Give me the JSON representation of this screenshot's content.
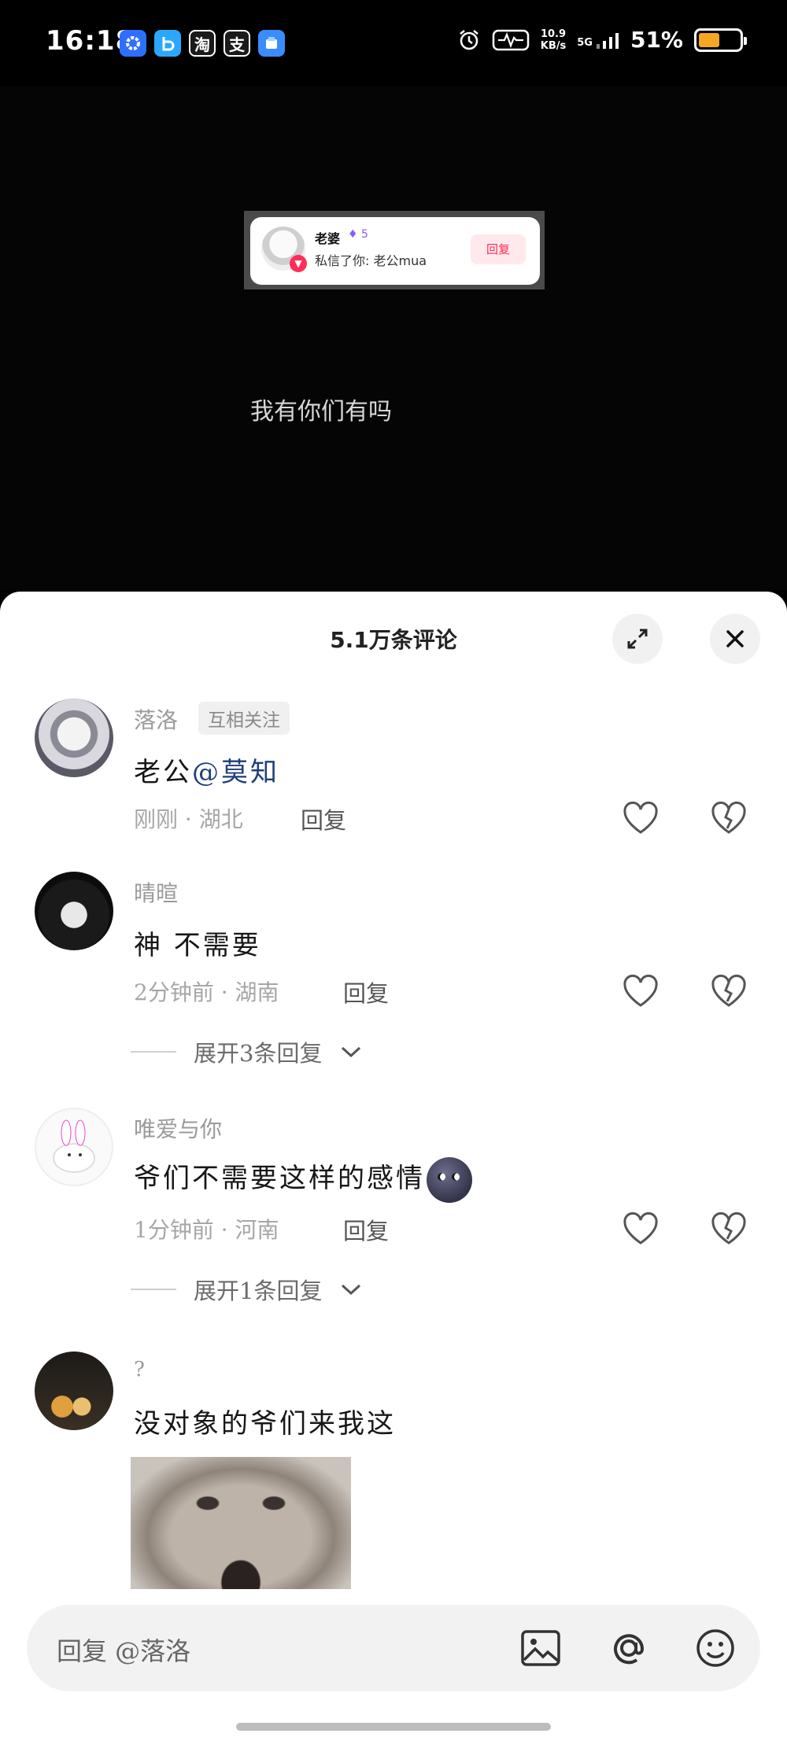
{
  "status_bar": {
    "time": "16:18",
    "apps": [
      {
        "icon": "gear-app-icon",
        "label": "",
        "color": "#2f6fff"
      },
      {
        "icon": "b-app-icon",
        "label": "",
        "color": "#2aa8ff"
      },
      {
        "icon": "taobao-app-icon",
        "label": "淘",
        "color": "#1a1a1a"
      },
      {
        "icon": "alipay-app-icon",
        "label": "支",
        "color": "#1a1a1a"
      },
      {
        "icon": "box-app-icon",
        "label": "",
        "color": "#3a8cff"
      }
    ],
    "net_speed_value": "10.9",
    "net_speed_unit": "KB/s",
    "signal_label": "5G",
    "battery_percent": "51%",
    "battery_level": 0.51
  },
  "video": {
    "notification": {
      "sender": "老婆",
      "fire_count": "5",
      "message": "私信了你: 老公mua",
      "reply_label": "回复"
    },
    "caption": "我有你们有吗"
  },
  "comments_sheet": {
    "title": "5.1万条评论",
    "comments": [
      {
        "user": "落洛",
        "tag": "互相关注",
        "text": "老公",
        "mention": "@莫知",
        "time_location": "刚刚 · 湖北",
        "reply_label": "回复"
      },
      {
        "user": "晴暄",
        "text": "神 不需要",
        "time_location": "2分钟前 · 湖南",
        "reply_label": "回复",
        "expand_label": "展开3条回复"
      },
      {
        "user": "唯爱与你",
        "text": "爷们不需要这样的感情",
        "time_location": "1分钟前 · 河南",
        "reply_label": "回复",
        "expand_label": "展开1条回复"
      },
      {
        "user": "?",
        "text": "没对象的爷们来我这"
      }
    ],
    "input_placeholder": "回复 @落洛"
  },
  "colors": {
    "accent_pink": "#ff2e57",
    "mention_blue": "#1e3f7a",
    "battery_orange": "#f5a623"
  }
}
